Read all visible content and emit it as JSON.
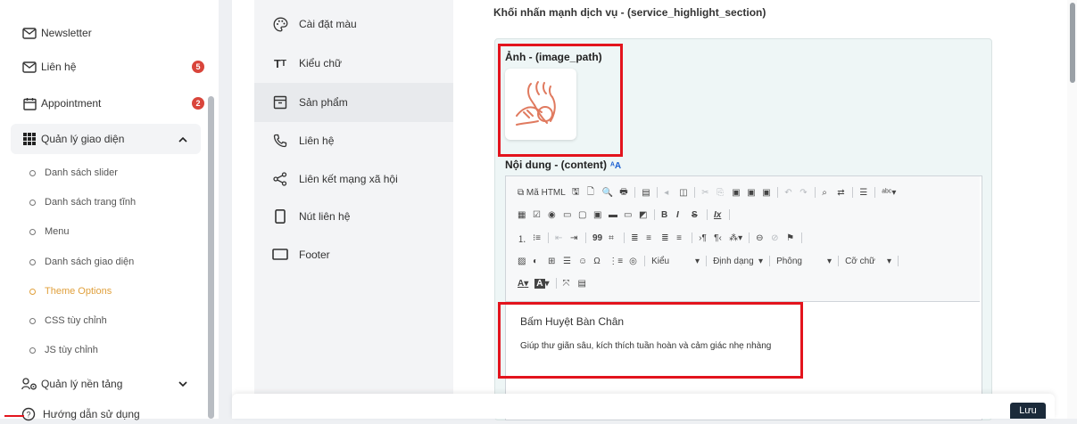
{
  "sidebar": {
    "items": [
      {
        "label": "Newsletter",
        "icon": "mail-icon"
      },
      {
        "label": "Liên hệ",
        "icon": "mail-icon",
        "badge": "5"
      },
      {
        "label": "Appointment",
        "icon": "calendar-icon",
        "badge": "2"
      },
      {
        "label": "Quản lý giao diện",
        "icon": "grid-icon"
      }
    ],
    "subitems": [
      {
        "label": "Danh sách slider"
      },
      {
        "label": "Danh sách trang tĩnh"
      },
      {
        "label": "Menu"
      },
      {
        "label": "Danh sách giao diện"
      },
      {
        "label": "Theme Options",
        "active": true
      },
      {
        "label": "CSS tùy chỉnh"
      },
      {
        "label": "JS tùy chỉnh"
      }
    ],
    "platform": {
      "label": "Quản lý nền tảng"
    },
    "help": {
      "label": "Hướng dẫn sử dụng"
    }
  },
  "settings_menu": [
    {
      "label": "Cài đặt màu",
      "icon": "palette-icon"
    },
    {
      "label": "Kiểu chữ",
      "icon": "typography-icon"
    },
    {
      "label": "Sản phẩm",
      "icon": "product-icon"
    },
    {
      "label": "Liên hệ",
      "icon": "phone-icon"
    },
    {
      "label": "Liên kết mạng xã hội",
      "icon": "share-icon"
    },
    {
      "label": "Nút liên hệ",
      "icon": "mobile-icon"
    },
    {
      "label": "Footer",
      "icon": "monitor-icon"
    }
  ],
  "main": {
    "section_title": "Khối nhấn mạnh dịch vụ - (service_highlight_section)",
    "image_label": "Ảnh - (image_path)",
    "content_label": "Nội dung - (content)",
    "content_lang_icon": "translate-icon",
    "editor": {
      "source_label": "Mã HTML",
      "bold": "B",
      "italic": "I",
      "strike": "S",
      "clear_format": "Ix",
      "quote": "99",
      "style_dd": "Kiểu",
      "format_dd": "Định dạng",
      "font_dd": "Phông",
      "size_dd": "Cỡ chữ",
      "text_color": "A",
      "bg_color": "A",
      "doc_title": "Bấm Huyệt Bàn Chân",
      "doc_text": "Giúp thư giãn sâu, kích thích tuần hoàn và cảm giác nhẹ nhàng"
    },
    "save_label": "Lưu"
  },
  "colors": {
    "accent": "#e0a03c",
    "badge": "#d9453b",
    "highlight_box": "#e3141d",
    "save_button": "#1b2a3a"
  }
}
